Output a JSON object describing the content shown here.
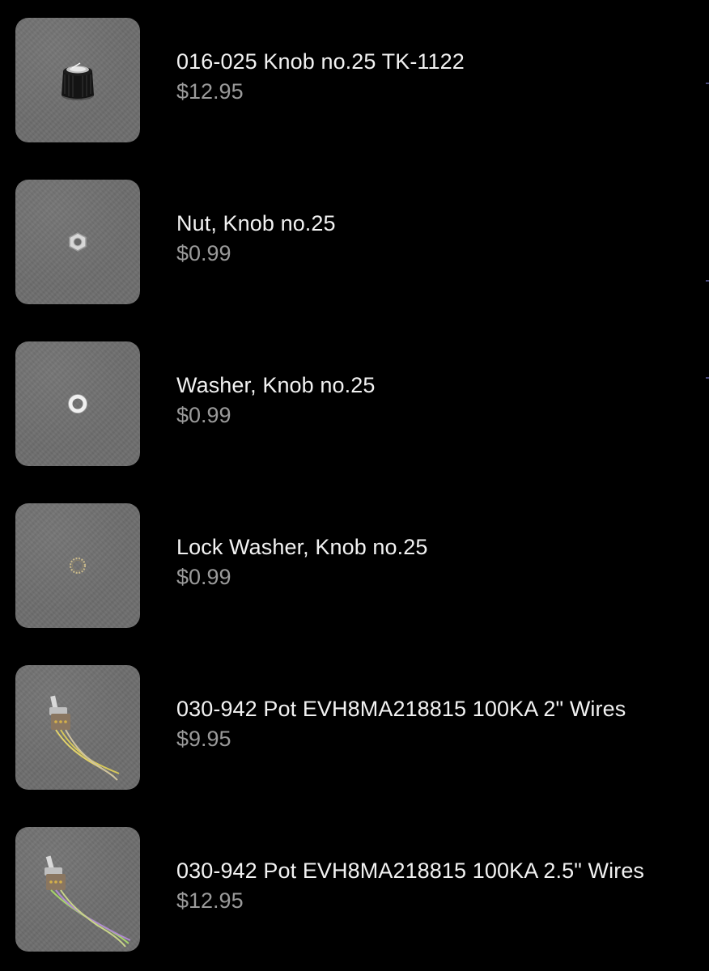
{
  "products": [
    {
      "title": "016-025 Knob no.25 TK-1122",
      "price": "$12.95",
      "image_icon": "knob-icon"
    },
    {
      "title": "Nut, Knob no.25",
      "price": "$0.99",
      "image_icon": "hex-nut-icon"
    },
    {
      "title": "Washer, Knob no.25",
      "price": "$0.99",
      "image_icon": "washer-icon"
    },
    {
      "title": "Lock Washer, Knob no.25",
      "price": "$0.99",
      "image_icon": "lock-washer-icon"
    },
    {
      "title": "030-942 Pot EVH8MA218815 100KA 2\" Wires",
      "price": "$9.95",
      "image_icon": "potentiometer-icon"
    },
    {
      "title": "030-942 Pot EVH8MA218815 100KA 2.5\" Wires",
      "price": "$12.95",
      "image_icon": "potentiometer-icon"
    }
  ],
  "colors": {
    "background": "#000000",
    "title_text": "#f2f2f2",
    "price_text": "#9a9a9a",
    "thumbnail_bg": "#6e6e6e"
  }
}
